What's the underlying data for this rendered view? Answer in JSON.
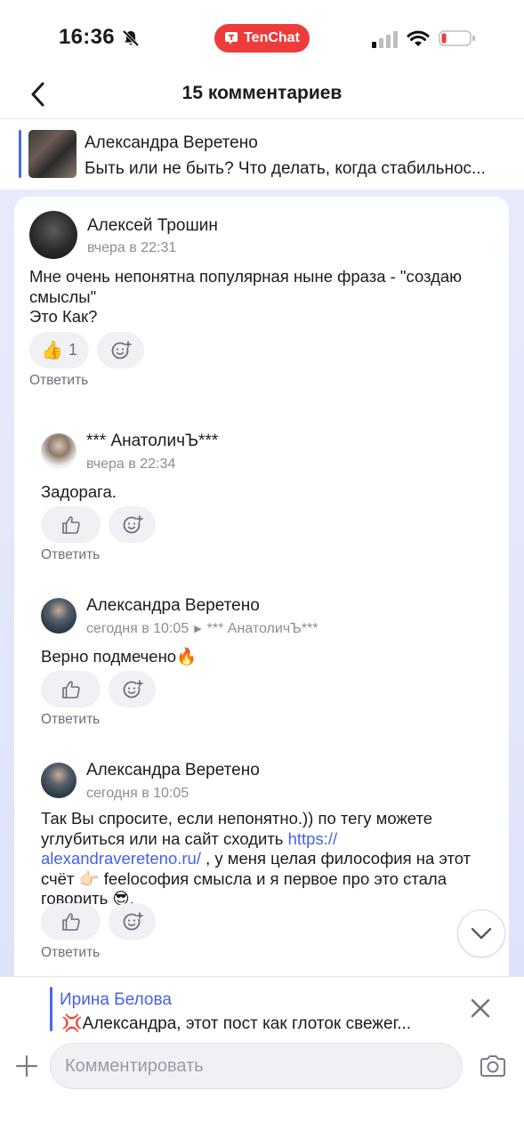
{
  "status_bar": {
    "time": "16:36",
    "app_name": "TenChat",
    "colors": {
      "pill": "#ee3b3b"
    }
  },
  "header": {
    "title": "15  комментариев"
  },
  "post_preview": {
    "author": "Александра Веретено",
    "text": "Быть или не быть? Что делать, когда стабильнос..."
  },
  "comments": [
    {
      "author": "Алексей Трошин",
      "time": "вчера в 22:31",
      "text_line1": "Мне очень непонятна популярная ныне фраза - \"создаю",
      "text_line2": "смыслы\"",
      "text_line3": "Это Как?",
      "like_emoji": "👍",
      "like_count": "1",
      "reply_label": "Ответить"
    },
    {
      "author": "*** АнатоличЪ***",
      "time": "вчера в 22:34",
      "text": "Задорага.",
      "reply_label": "Ответить"
    },
    {
      "author": "Александра Веретено",
      "time": "сегодня в 10:05",
      "reply_to": "*** АнатоличЪ***",
      "text": "Верно подмечено🔥",
      "reply_label": "Ответить"
    },
    {
      "author": "Александра Веретено",
      "time": "сегодня в 10:05",
      "text_line1": "Так Вы спросите, если непонятно.)) по тегу можете",
      "text_line2a": "углубиться или на сайт сходить ",
      "link_part1": "https://",
      "link_part2": "alexandravereteno.ru/",
      "text_line3a": " ,  у меня целая философия на этот",
      "text_line4": "счёт 👉🏻 feelософия смысла и я первое про это стала",
      "text_line5": "говорить 😎.",
      "reply_label": "Ответить"
    }
  ],
  "reply_quote": {
    "author": "Ирина Белова",
    "text": "💢Александра, этот пост как глоток свежег..."
  },
  "composer": {
    "placeholder": "Комментировать"
  },
  "colors": {
    "accent": "#4561e8",
    "feed_bg": "#e3e7fb"
  }
}
